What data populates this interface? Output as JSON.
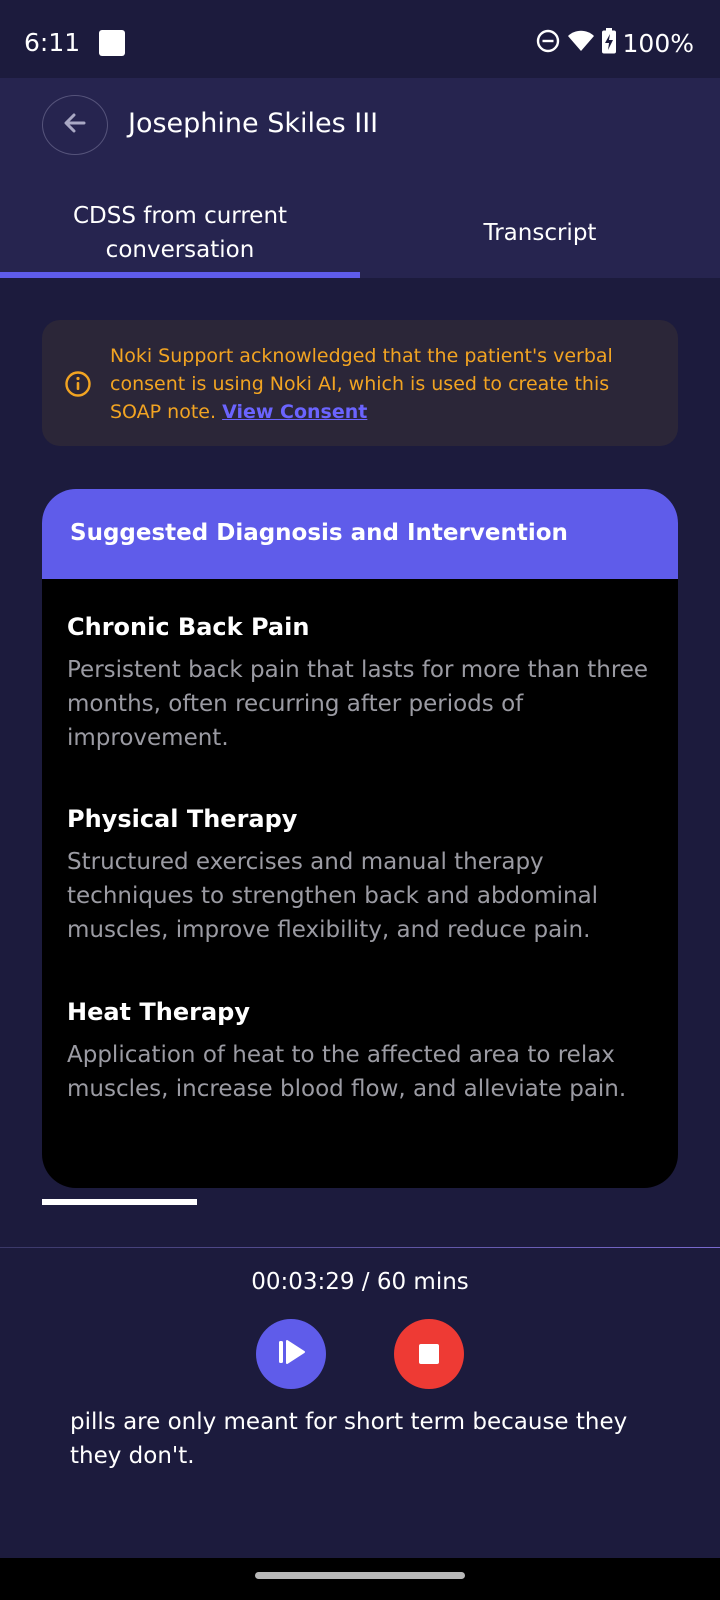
{
  "status_bar": {
    "time": "6:11",
    "battery": "100%",
    "icons": [
      "app-notification-icon",
      "do-not-disturb-icon",
      "wifi-icon",
      "battery-charging-icon"
    ]
  },
  "header": {
    "patient_name": "Josephine Skiles III",
    "back_icon": "arrow-left-icon",
    "tabs": [
      {
        "label": "CDSS from current conversation",
        "active": true
      },
      {
        "label": "Transcript",
        "active": false
      }
    ]
  },
  "consent": {
    "text": "Noki Support acknowledged that the patient's verbal consent is using Noki AI, which is used to create this SOAP note.",
    "link_label": "View Consent",
    "icon": "info-icon"
  },
  "card": {
    "title": "Suggested Diagnosis and Intervention",
    "items": [
      {
        "name": "Chronic Back Pain",
        "description": "Persistent back pain that lasts for more than three months, often recurring after periods of improvement."
      },
      {
        "name": "Physical Therapy",
        "description": "Structured exercises and manual therapy techniques to strengthen back and abdominal muscles, improve flexibility, and reduce pain."
      },
      {
        "name": "Heat Therapy",
        "description": "Application of heat to the affected area to relax muscles, increase blood flow, and alleviate pain."
      }
    ]
  },
  "recording": {
    "timer": "00:03:29 / 60 mins",
    "resume_icon": "resume-icon",
    "stop_icon": "stop-icon",
    "live_text": "pills are only meant for short term because they they don't."
  },
  "colors": {
    "background": "#1c1b3d",
    "accent": "#5f5cea",
    "warning": "#f2a422",
    "stop": "#ee3a34"
  }
}
